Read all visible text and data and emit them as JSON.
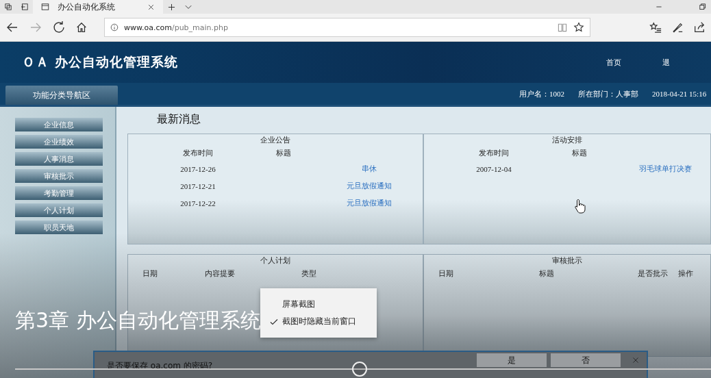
{
  "browser": {
    "tab_title": "办公自动化系统",
    "url_domain": "www.oa.com",
    "url_path": "/pub_main.php"
  },
  "header": {
    "logo": "ＯＡ 办公自动化管理系统",
    "links": [
      "首页",
      "退"
    ]
  },
  "navbar": {
    "title": "功能分类导航区",
    "user": "用户名：1002",
    "department": "所在部门：人事部",
    "datetime": "2018-04-21 15:16"
  },
  "sidebar": {
    "items": [
      "企业信息",
      "企业绩效",
      "人事消息",
      "审核批示",
      "考勤管理",
      "个人计划",
      "职员天地"
    ]
  },
  "main": {
    "heading": "最新消息",
    "panels": [
      {
        "title": "企业公告",
        "columns": [
          "发布时间",
          "标题"
        ],
        "rows": [
          [
            "2017-12-26",
            "串休"
          ],
          [
            "2017-12-21",
            "元旦放假通知"
          ],
          [
            "2017-12-22",
            "元旦放假通知"
          ]
        ]
      },
      {
        "title": "活动安排",
        "columns": [
          "发布时间",
          "标题"
        ],
        "rows": [
          [
            "2007-12-04",
            "羽毛球单打决赛"
          ]
        ]
      },
      {
        "title": "个人计划",
        "columns": [
          "日期",
          "内容提要",
          "类型"
        ]
      },
      {
        "title": "审核批示",
        "columns": [
          "日期",
          "标题",
          "是否批示",
          "操作"
        ]
      }
    ]
  },
  "video": {
    "chapter_title": "第3章  办公自动化管理系统",
    "progress": {
      "level": 0.494
    }
  },
  "context_menu": {
    "items": [
      {
        "label": "屏幕截图",
        "checked": false
      },
      {
        "label": "截图时隐藏当前窗口",
        "checked": true
      }
    ]
  },
  "password_bar": {
    "message": "是否要保存 oa.com 的密码?",
    "buttons": [
      "是",
      "否"
    ]
  }
}
